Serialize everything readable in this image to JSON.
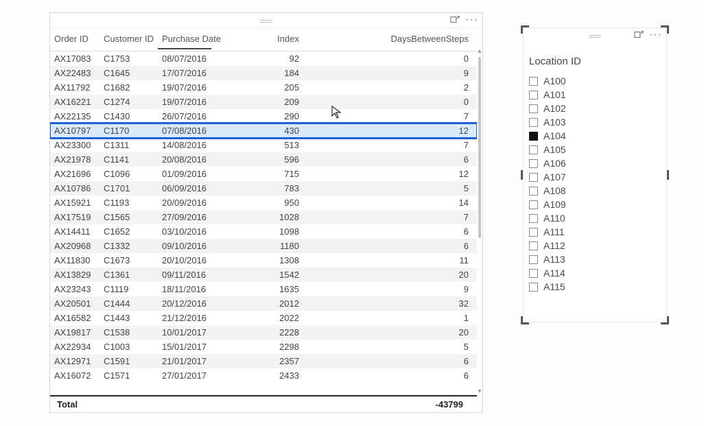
{
  "table": {
    "columns": [
      "Order ID",
      "Customer ID",
      "Purchase Date",
      "Index",
      "DaysBetweenSteps"
    ],
    "sort_column": "Purchase Date",
    "highlighted": "AX10797",
    "rows": [
      {
        "order_id": "AX17083",
        "customer_id": "C1753",
        "date": "08/07/2016",
        "index": 92,
        "days": 0
      },
      {
        "order_id": "AX22483",
        "customer_id": "C1645",
        "date": "17/07/2016",
        "index": 184,
        "days": 9
      },
      {
        "order_id": "AX11792",
        "customer_id": "C1682",
        "date": "19/07/2016",
        "index": 205,
        "days": 2
      },
      {
        "order_id": "AX16221",
        "customer_id": "C1274",
        "date": "19/07/2016",
        "index": 209,
        "days": 0
      },
      {
        "order_id": "AX22135",
        "customer_id": "C1430",
        "date": "26/07/2016",
        "index": 290,
        "days": 7
      },
      {
        "order_id": "AX10797",
        "customer_id": "C1170",
        "date": "07/08/2016",
        "index": 430,
        "days": 12
      },
      {
        "order_id": "AX23300",
        "customer_id": "C1311",
        "date": "14/08/2016",
        "index": 513,
        "days": 7
      },
      {
        "order_id": "AX21978",
        "customer_id": "C1141",
        "date": "20/08/2016",
        "index": 596,
        "days": 6
      },
      {
        "order_id": "AX21696",
        "customer_id": "C1096",
        "date": "01/09/2016",
        "index": 715,
        "days": 12
      },
      {
        "order_id": "AX10786",
        "customer_id": "C1701",
        "date": "06/09/2016",
        "index": 783,
        "days": 5
      },
      {
        "order_id": "AX15921",
        "customer_id": "C1193",
        "date": "20/09/2016",
        "index": 950,
        "days": 14
      },
      {
        "order_id": "AX17519",
        "customer_id": "C1565",
        "date": "27/09/2016",
        "index": 1028,
        "days": 7
      },
      {
        "order_id": "AX14411",
        "customer_id": "C1652",
        "date": "03/10/2016",
        "index": 1098,
        "days": 6
      },
      {
        "order_id": "AX20968",
        "customer_id": "C1332",
        "date": "09/10/2016",
        "index": 1180,
        "days": 6
      },
      {
        "order_id": "AX11830",
        "customer_id": "C1673",
        "date": "20/10/2016",
        "index": 1308,
        "days": 11
      },
      {
        "order_id": "AX13829",
        "customer_id": "C1361",
        "date": "09/11/2016",
        "index": 1542,
        "days": 20
      },
      {
        "order_id": "AX23243",
        "customer_id": "C1119",
        "date": "18/11/2016",
        "index": 1635,
        "days": 9
      },
      {
        "order_id": "AX20501",
        "customer_id": "C1444",
        "date": "20/12/2016",
        "index": 2012,
        "days": 32
      },
      {
        "order_id": "AX16582",
        "customer_id": "C1443",
        "date": "21/12/2016",
        "index": 2022,
        "days": 1
      },
      {
        "order_id": "AX19817",
        "customer_id": "C1538",
        "date": "10/01/2017",
        "index": 2228,
        "days": 20
      },
      {
        "order_id": "AX22934",
        "customer_id": "C1003",
        "date": "15/01/2017",
        "index": 2298,
        "days": 5
      },
      {
        "order_id": "AX12971",
        "customer_id": "C1591",
        "date": "21/01/2017",
        "index": 2357,
        "days": 6
      },
      {
        "order_id": "AX16072",
        "customer_id": "C1571",
        "date": "27/01/2017",
        "index": 2433,
        "days": 6
      }
    ],
    "total_label": "Total",
    "total_value": "-43799"
  },
  "slicer": {
    "title": "Location ID",
    "items": [
      {
        "label": "A100",
        "checked": false
      },
      {
        "label": "A101",
        "checked": false
      },
      {
        "label": "A102",
        "checked": false
      },
      {
        "label": "A103",
        "checked": false
      },
      {
        "label": "A104",
        "checked": true
      },
      {
        "label": "A105",
        "checked": false
      },
      {
        "label": "A106",
        "checked": false
      },
      {
        "label": "A107",
        "checked": false
      },
      {
        "label": "A108",
        "checked": false
      },
      {
        "label": "A109",
        "checked": false
      },
      {
        "label": "A110",
        "checked": false
      },
      {
        "label": "A111",
        "checked": false
      },
      {
        "label": "A112",
        "checked": false
      },
      {
        "label": "A113",
        "checked": false
      },
      {
        "label": "A114",
        "checked": false
      },
      {
        "label": "A115",
        "checked": false
      }
    ]
  }
}
